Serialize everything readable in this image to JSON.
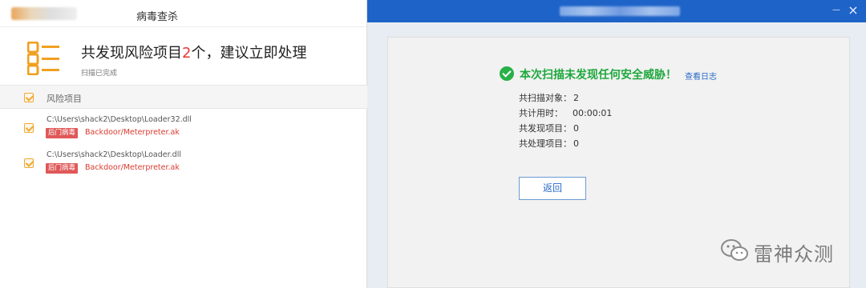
{
  "left_window": {
    "title": "病毒查杀",
    "summary": {
      "headline_prefix": "共发现风险项目",
      "count": "2",
      "headline_suffix": "个，建议立即处理",
      "sub": "扫描已完成"
    },
    "list_header": "风险项目",
    "items": [
      {
        "path": "C:\\Users\\shack2\\Desktop\\Loader32.dll",
        "tag": "后门病毒",
        "virus": "Backdoor/Meterpreter.ak"
      },
      {
        "path": "C:\\Users\\shack2\\Desktop\\Loader.dll",
        "tag": "后门病毒",
        "virus": "Backdoor/Meterpreter.ak"
      }
    ]
  },
  "right_window": {
    "status": "本次扫描未发现任何安全威胁！",
    "log_link": "查看日志",
    "stats": [
      {
        "label": "共扫描对象：",
        "value": "2"
      },
      {
        "label": "共计用时：",
        "value": "00:00:01"
      },
      {
        "label": "共发现项目：",
        "value": "0"
      },
      {
        "label": "共处理项目：",
        "value": "0"
      }
    ],
    "back_button": "返回",
    "minimize_glyph": "—",
    "close_glyph": "×"
  },
  "watermark": {
    "text": "雷神众测"
  },
  "colors": {
    "accent_blue": "#1e63c8",
    "success_green": "#27b148",
    "danger_red": "#e53935",
    "checkbox_orange": "#f0a830"
  },
  "icons": [
    "list-icon",
    "check-circle-icon",
    "wechat-icon"
  ]
}
